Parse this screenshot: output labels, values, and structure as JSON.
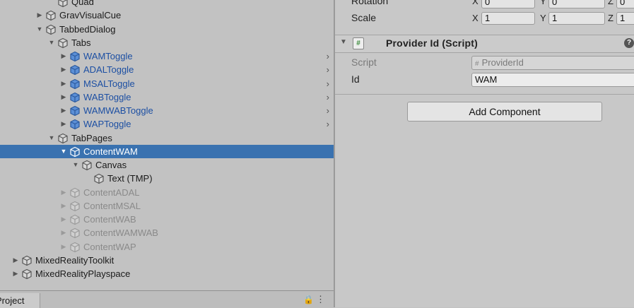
{
  "hierarchy": {
    "rows": [
      {
        "label": "Quad",
        "depth": 5,
        "expand": "none",
        "kind": "object",
        "state": "normal",
        "chevron": false
      },
      {
        "label": "GravVisualCue",
        "depth": 4,
        "expand": "collapsed",
        "kind": "object",
        "state": "normal",
        "chevron": false
      },
      {
        "label": "TabbedDialog",
        "depth": 4,
        "expand": "expanded",
        "kind": "object",
        "state": "normal",
        "chevron": false
      },
      {
        "label": "Tabs",
        "depth": 5,
        "expand": "expanded",
        "kind": "object",
        "state": "normal",
        "chevron": false
      },
      {
        "label": "WAMToggle",
        "depth": 6,
        "expand": "collapsed",
        "kind": "prefab",
        "state": "normal",
        "chevron": true
      },
      {
        "label": "ADALToggle",
        "depth": 6,
        "expand": "collapsed",
        "kind": "prefab",
        "state": "normal",
        "chevron": true
      },
      {
        "label": "MSALToggle",
        "depth": 6,
        "expand": "collapsed",
        "kind": "prefab",
        "state": "normal",
        "chevron": true
      },
      {
        "label": "WABToggle",
        "depth": 6,
        "expand": "collapsed",
        "kind": "prefab",
        "state": "normal",
        "chevron": true
      },
      {
        "label": "WAMWABToggle",
        "depth": 6,
        "expand": "collapsed",
        "kind": "prefab",
        "state": "normal",
        "chevron": true
      },
      {
        "label": "WAPToggle",
        "depth": 6,
        "expand": "collapsed",
        "kind": "prefab",
        "state": "normal",
        "chevron": true
      },
      {
        "label": "TabPages",
        "depth": 5,
        "expand": "expanded",
        "kind": "object",
        "state": "normal",
        "chevron": false
      },
      {
        "label": "ContentWAM",
        "depth": 6,
        "expand": "expanded",
        "kind": "object",
        "state": "selected",
        "chevron": false
      },
      {
        "label": "Canvas",
        "depth": 7,
        "expand": "expanded",
        "kind": "object",
        "state": "normal",
        "chevron": false
      },
      {
        "label": "Text (TMP)",
        "depth": 8,
        "expand": "none",
        "kind": "object",
        "state": "normal",
        "chevron": false
      },
      {
        "label": "ContentADAL",
        "depth": 6,
        "expand": "collapsed",
        "kind": "object",
        "state": "inactive",
        "chevron": false
      },
      {
        "label": "ContentMSAL",
        "depth": 6,
        "expand": "collapsed",
        "kind": "object",
        "state": "inactive",
        "chevron": false
      },
      {
        "label": "ContentWAB",
        "depth": 6,
        "expand": "collapsed",
        "kind": "object",
        "state": "inactive",
        "chevron": false
      },
      {
        "label": "ContentWAMWAB",
        "depth": 6,
        "expand": "collapsed",
        "kind": "object",
        "state": "inactive",
        "chevron": false
      },
      {
        "label": "ContentWAP",
        "depth": 6,
        "expand": "collapsed",
        "kind": "object",
        "state": "inactive",
        "chevron": false
      },
      {
        "label": "MixedRealityToolkit",
        "depth": 2,
        "expand": "collapsed",
        "kind": "object",
        "state": "normal",
        "chevron": false
      },
      {
        "label": "MixedRealityPlayspace",
        "depth": 2,
        "expand": "collapsed",
        "kind": "object",
        "state": "normal",
        "chevron": false
      }
    ]
  },
  "project_tab": {
    "label": "Project"
  },
  "inspector": {
    "transform": {
      "rotation_label": "Rotation",
      "rotation": {
        "x": "0",
        "y": "0",
        "z": "0"
      },
      "scale_label": "Scale",
      "scale": {
        "x": "1",
        "y": "1",
        "z": "1"
      },
      "axis_x": "X",
      "axis_y": "Y",
      "axis_z": "Z"
    },
    "component": {
      "title": "Provider Id (Script)",
      "script_label": "Script",
      "script_value": "ProviderId",
      "id_label": "Id",
      "id_value": "WAM"
    },
    "add_component_label": "Add Component"
  },
  "colors": {
    "selection": "#3a72b0",
    "prefab_text": "#1c4fa3",
    "inactive_text": "#8a8a8a"
  }
}
